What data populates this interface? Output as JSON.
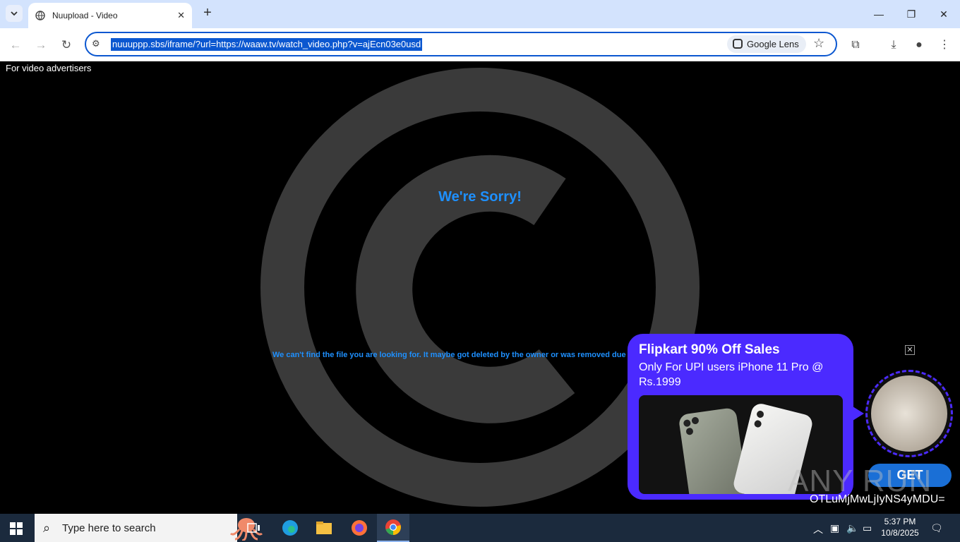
{
  "browser": {
    "tab_title": "Nuupload - Video",
    "url": "nuuuppp.sbs/iframe/?url=https://waaw.tv/watch_video.php?v=ajEcn03e0usd",
    "lens_label": "Google Lens"
  },
  "page": {
    "advertisers_text": "For video advertisers",
    "sorry_title": "We're Sorry!",
    "sorry_message": "We can't find the file you are looking for. It maybe got deleted by the owner or was removed due a co"
  },
  "ad": {
    "title": "Flipkart 90% Off Sales",
    "subtitle": "Only For UPI users iPhone 11 Pro @ Rs.1999",
    "button_label": "GET",
    "close_symbol": "✕"
  },
  "overlay": {
    "watermark": "ANY RUN",
    "code_text": "OTLuMjMwLjIyNS4yMDU="
  },
  "taskbar": {
    "search_placeholder": "Type here to search",
    "time": "5:37 PM",
    "date": "10/8/2025"
  },
  "colors": {
    "accent": "#0b57d0",
    "sorry_blue": "#1e90ff",
    "ad_purple": "#4b2aff",
    "taskbar_bg": "#1b2a3d"
  }
}
